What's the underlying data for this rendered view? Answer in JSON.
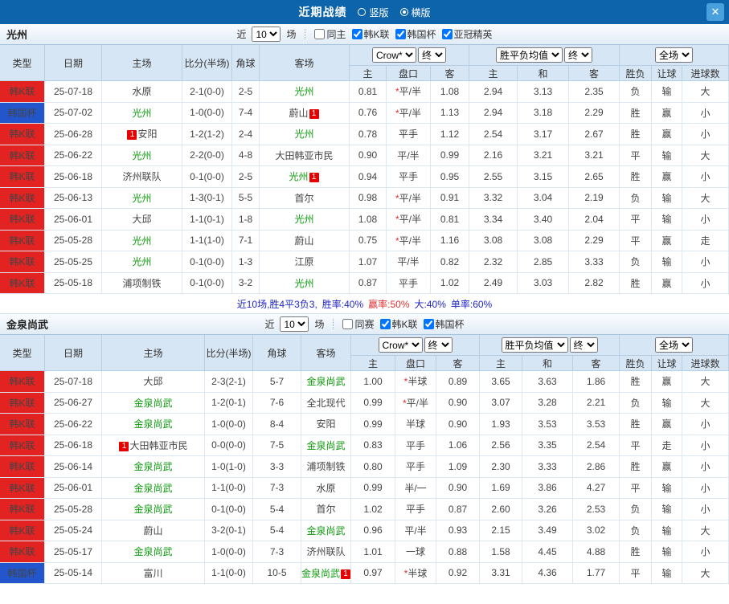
{
  "titlebar": {
    "title": "近期战绩",
    "layout_radios": [
      {
        "label": "竖版",
        "selected": false
      },
      {
        "label": "横版",
        "selected": true
      }
    ],
    "close_icon": "✕"
  },
  "colors": {
    "titlebar_bg": "#0e64aa",
    "close_btn_bg": "#4aa0dc",
    "header_bg": "#d7e6f4",
    "league_k": "#e32222",
    "league_cup": "#2356cc",
    "focal_team": "#0f9b0f",
    "score": "#e03030",
    "win": "#e03030",
    "loss": "#18a018",
    "draw": "#2244cc",
    "summary_blue": "#2026c8",
    "summary_red": "#e03030"
  },
  "sections": [
    {
      "team": "光州",
      "filter": {
        "near_label": "近",
        "count": "10",
        "games_label": "场",
        "checkboxes": [
          {
            "label": "同主",
            "checked": false
          },
          {
            "label": "韩K联",
            "checked": true
          },
          {
            "label": "韩国杯",
            "checked": true
          },
          {
            "label": "亚冠精英",
            "checked": true
          }
        ]
      },
      "header": {
        "base_columns": [
          "类型",
          "日期",
          "主场",
          "比分(半场)",
          "角球",
          "客场"
        ],
        "odds_company": "Crow*",
        "odds_time": "终",
        "europe_label": "胜平负均值",
        "europe_time": "终",
        "scope_label": "全场",
        "sub_columns": [
          "主",
          "盘口",
          "客",
          "主",
          "和",
          "客",
          "胜负",
          "让球",
          "进球数"
        ]
      },
      "rows": [
        {
          "league": "韩K联",
          "cup": false,
          "date": "25-07-18",
          "home": {
            "name": "水原"
          },
          "score": "2-1(0-0)",
          "corner": "2-5",
          "away": {
            "name": "光州",
            "focal": true
          },
          "ah": [
            "0.81",
            "*平/半",
            "1.08"
          ],
          "eu": [
            "2.94",
            "3.13",
            "2.35"
          ],
          "res": [
            "负",
            "输",
            "大"
          ]
        },
        {
          "league": "韩国杯",
          "cup": true,
          "date": "25-07-02",
          "home": {
            "name": "光州",
            "focal": true
          },
          "score": "1-0(0-0)",
          "corner": "7-4",
          "away": {
            "name": "蔚山",
            "badge": "1",
            "badge_pos": "right"
          },
          "ah": [
            "0.76",
            "*平/半",
            "1.13"
          ],
          "eu": [
            "2.94",
            "3.18",
            "2.29"
          ],
          "res": [
            "胜",
            "赢",
            "小"
          ]
        },
        {
          "league": "韩K联",
          "cup": false,
          "date": "25-06-28",
          "home": {
            "name": "安阳",
            "badge": "1",
            "badge_pos": "left"
          },
          "score": "1-2(1-2)",
          "corner": "2-4",
          "away": {
            "name": "光州",
            "focal": true
          },
          "ah": [
            "0.78",
            "平手",
            "1.12"
          ],
          "eu": [
            "2.54",
            "3.17",
            "2.67"
          ],
          "res": [
            "胜",
            "赢",
            "小"
          ]
        },
        {
          "league": "韩K联",
          "cup": false,
          "date": "25-06-22",
          "home": {
            "name": "光州",
            "focal": true
          },
          "score": "2-2(0-0)",
          "corner": "4-8",
          "away": {
            "name": "大田韩亚市民"
          },
          "ah": [
            "0.90",
            "平/半",
            "0.99"
          ],
          "eu": [
            "2.16",
            "3.21",
            "3.21"
          ],
          "res": [
            "平",
            "输",
            "大"
          ]
        },
        {
          "league": "韩K联",
          "cup": false,
          "date": "25-06-18",
          "home": {
            "name": "济州联队"
          },
          "score": "0-1(0-0)",
          "corner": "2-5",
          "away": {
            "name": "光州",
            "focal": true,
            "badge": "1",
            "badge_pos": "right"
          },
          "ah": [
            "0.94",
            "平手",
            "0.95"
          ],
          "eu": [
            "2.55",
            "3.15",
            "2.65"
          ],
          "res": [
            "胜",
            "赢",
            "小"
          ]
        },
        {
          "league": "韩K联",
          "cup": false,
          "date": "25-06-13",
          "home": {
            "name": "光州",
            "focal": true
          },
          "score": "1-3(0-1)",
          "corner": "5-5",
          "away": {
            "name": "首尔"
          },
          "ah": [
            "0.98",
            "*平/半",
            "0.91"
          ],
          "eu": [
            "3.32",
            "3.04",
            "2.19"
          ],
          "res": [
            "负",
            "输",
            "大"
          ]
        },
        {
          "league": "韩K联",
          "cup": false,
          "date": "25-06-01",
          "home": {
            "name": "大邱"
          },
          "score": "1-1(0-1)",
          "corner": "1-8",
          "away": {
            "name": "光州",
            "focal": true
          },
          "ah": [
            "1.08",
            "*平/半",
            "0.81"
          ],
          "eu": [
            "3.34",
            "3.40",
            "2.04"
          ],
          "res": [
            "平",
            "输",
            "小"
          ]
        },
        {
          "league": "韩K联",
          "cup": false,
          "date": "25-05-28",
          "home": {
            "name": "光州",
            "focal": true
          },
          "score": "1-1(1-0)",
          "corner": "7-1",
          "away": {
            "name": "蔚山"
          },
          "ah": [
            "0.75",
            "*平/半",
            "1.16"
          ],
          "eu": [
            "3.08",
            "3.08",
            "2.29"
          ],
          "res": [
            "平",
            "赢",
            "走"
          ]
        },
        {
          "league": "韩K联",
          "cup": false,
          "date": "25-05-25",
          "home": {
            "name": "光州",
            "focal": true
          },
          "score": "0-1(0-0)",
          "corner": "1-3",
          "away": {
            "name": "江原"
          },
          "ah": [
            "1.07",
            "平/半",
            "0.82"
          ],
          "eu": [
            "2.32",
            "2.85",
            "3.33"
          ],
          "res": [
            "负",
            "输",
            "小"
          ]
        },
        {
          "league": "韩K联",
          "cup": false,
          "date": "25-05-18",
          "home": {
            "name": "浦项制铁"
          },
          "score": "0-1(0-0)",
          "corner": "3-2",
          "away": {
            "name": "光州",
            "focal": true
          },
          "ah": [
            "0.87",
            "平手",
            "1.02"
          ],
          "eu": [
            "2.49",
            "3.03",
            "2.82"
          ],
          "res": [
            "胜",
            "赢",
            "小"
          ]
        }
      ],
      "summary": [
        {
          "text": "近10场,胜4平3负3,",
          "color": "blue"
        },
        {
          "text": "胜率:40%",
          "color": "blue"
        },
        {
          "text": "赢率:50%",
          "color": "red"
        },
        {
          "text": "大:40%",
          "color": "blue"
        },
        {
          "text": "单率:60%",
          "color": "blue"
        }
      ]
    },
    {
      "team": "金泉尚武",
      "filter": {
        "near_label": "近",
        "count": "10",
        "games_label": "场",
        "checkboxes": [
          {
            "label": "同赛",
            "checked": false
          },
          {
            "label": "韩K联",
            "checked": true
          },
          {
            "label": "韩国杯",
            "checked": true
          }
        ]
      },
      "header": {
        "base_columns": [
          "类型",
          "日期",
          "主场",
          "比分(半场)",
          "角球",
          "客场"
        ],
        "odds_company": "Crow*",
        "odds_time": "终",
        "europe_label": "胜平负均值",
        "europe_time": "终",
        "scope_label": "全场",
        "sub_columns": [
          "主",
          "盘口",
          "客",
          "主",
          "和",
          "客",
          "胜负",
          "让球",
          "进球数"
        ]
      },
      "rows": [
        {
          "league": "韩K联",
          "cup": false,
          "date": "25-07-18",
          "home": {
            "name": "大邱"
          },
          "score": "2-3(2-1)",
          "corner": "5-7",
          "away": {
            "name": "金泉尚武",
            "focal": true
          },
          "ah": [
            "1.00",
            "*半球",
            "0.89"
          ],
          "eu": [
            "3.65",
            "3.63",
            "1.86"
          ],
          "res": [
            "胜",
            "赢",
            "大"
          ]
        },
        {
          "league": "韩K联",
          "cup": false,
          "date": "25-06-27",
          "home": {
            "name": "金泉尚武",
            "focal": true
          },
          "score": "1-2(0-1)",
          "corner": "7-6",
          "away": {
            "name": "全北现代"
          },
          "ah": [
            "0.99",
            "*平/半",
            "0.90"
          ],
          "eu": [
            "3.07",
            "3.28",
            "2.21"
          ],
          "res": [
            "负",
            "输",
            "大"
          ]
        },
        {
          "league": "韩K联",
          "cup": false,
          "date": "25-06-22",
          "home": {
            "name": "金泉尚武",
            "focal": true
          },
          "score": "1-0(0-0)",
          "corner": "8-4",
          "away": {
            "name": "安阳"
          },
          "ah": [
            "0.99",
            "半球",
            "0.90"
          ],
          "eu": [
            "1.93",
            "3.53",
            "3.53"
          ],
          "res": [
            "胜",
            "赢",
            "小"
          ]
        },
        {
          "league": "韩K联",
          "cup": false,
          "date": "25-06-18",
          "home": {
            "name": "大田韩亚市民",
            "badge": "1",
            "badge_pos": "left"
          },
          "score": "0-0(0-0)",
          "corner": "7-5",
          "away": {
            "name": "金泉尚武",
            "focal": true
          },
          "ah": [
            "0.83",
            "平手",
            "1.06"
          ],
          "eu": [
            "2.56",
            "3.35",
            "2.54"
          ],
          "res": [
            "平",
            "走",
            "小"
          ]
        },
        {
          "league": "韩K联",
          "cup": false,
          "date": "25-06-14",
          "home": {
            "name": "金泉尚武",
            "focal": true
          },
          "score": "1-0(1-0)",
          "corner": "3-3",
          "away": {
            "name": "浦项制铁"
          },
          "ah": [
            "0.80",
            "平手",
            "1.09"
          ],
          "eu": [
            "2.30",
            "3.33",
            "2.86"
          ],
          "res": [
            "胜",
            "赢",
            "小"
          ]
        },
        {
          "league": "韩K联",
          "cup": false,
          "date": "25-06-01",
          "home": {
            "name": "金泉尚武",
            "focal": true
          },
          "score": "1-1(0-0)",
          "corner": "7-3",
          "away": {
            "name": "水原"
          },
          "ah": [
            "0.99",
            "半/一",
            "0.90"
          ],
          "eu": [
            "1.69",
            "3.86",
            "4.27"
          ],
          "res": [
            "平",
            "输",
            "小"
          ]
        },
        {
          "league": "韩K联",
          "cup": false,
          "date": "25-05-28",
          "home": {
            "name": "金泉尚武",
            "focal": true
          },
          "score": "0-1(0-0)",
          "corner": "5-4",
          "away": {
            "name": "首尔"
          },
          "ah": [
            "1.02",
            "平手",
            "0.87"
          ],
          "eu": [
            "2.60",
            "3.26",
            "2.53"
          ],
          "res": [
            "负",
            "输",
            "小"
          ]
        },
        {
          "league": "韩K联",
          "cup": false,
          "date": "25-05-24",
          "home": {
            "name": "蔚山"
          },
          "score": "3-2(0-1)",
          "corner": "5-4",
          "away": {
            "name": "金泉尚武",
            "focal": true
          },
          "ah": [
            "0.96",
            "平/半",
            "0.93"
          ],
          "eu": [
            "2.15",
            "3.49",
            "3.02"
          ],
          "res": [
            "负",
            "输",
            "大"
          ]
        },
        {
          "league": "韩K联",
          "cup": false,
          "date": "25-05-17",
          "home": {
            "name": "金泉尚武",
            "focal": true
          },
          "score": "1-0(0-0)",
          "corner": "7-3",
          "away": {
            "name": "济州联队"
          },
          "ah": [
            "1.01",
            "一球",
            "0.88"
          ],
          "eu": [
            "1.58",
            "4.45",
            "4.88"
          ],
          "res": [
            "胜",
            "输",
            "小"
          ]
        },
        {
          "league": "韩国杯",
          "cup": true,
          "date": "25-05-14",
          "home": {
            "name": "富川"
          },
          "score": "1-1(0-0)",
          "corner": "10-5",
          "away": {
            "name": "金泉尚武",
            "focal": true,
            "badge": "1",
            "badge_pos": "right"
          },
          "ah": [
            "0.97",
            "*半球",
            "0.92"
          ],
          "eu": [
            "3.31",
            "4.36",
            "1.77"
          ],
          "res": [
            "平",
            "输",
            "大"
          ]
        }
      ]
    }
  ]
}
